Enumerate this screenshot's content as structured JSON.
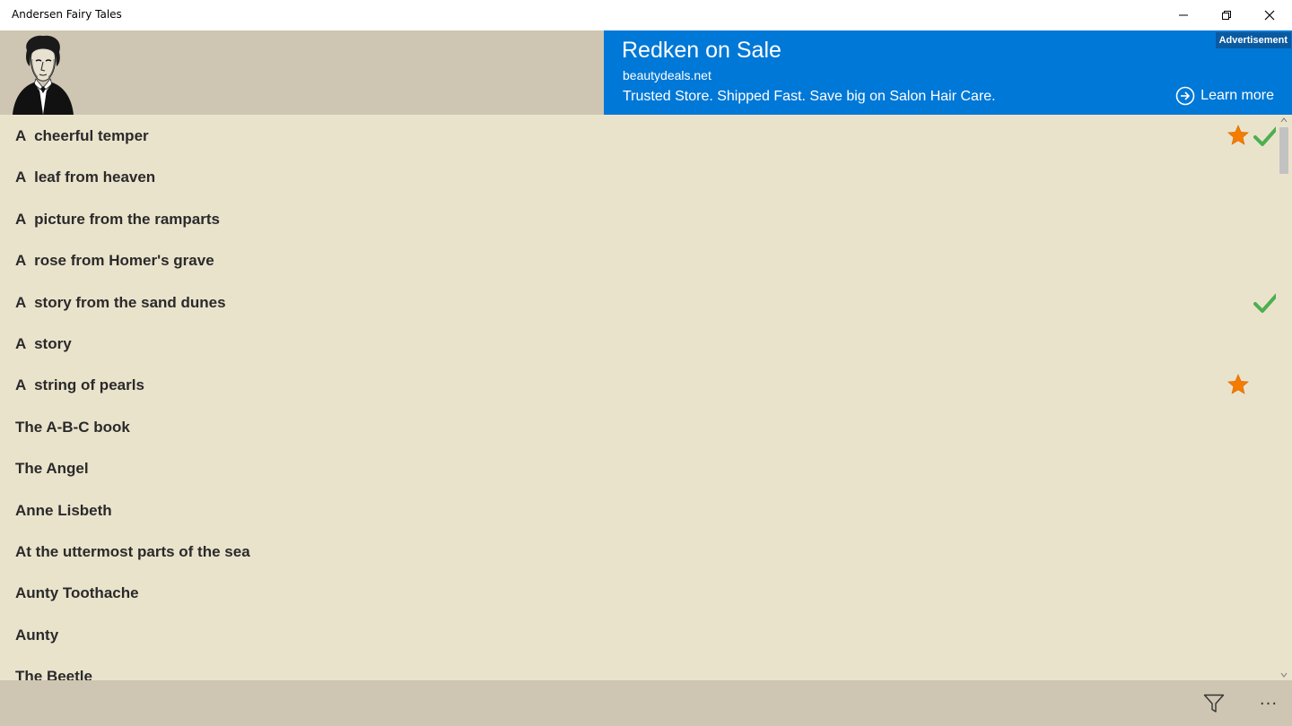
{
  "window": {
    "title": "Andersen Fairy Tales",
    "controls": [
      "minimize-icon",
      "restore-icon",
      "close-icon"
    ]
  },
  "header": {
    "portrait_icon": "andersen-portrait"
  },
  "ad": {
    "badge": "Advertisement",
    "title": "Redken on Sale",
    "domain": "beautydeals.net",
    "description": "Trusted Store. Shipped Fast. Save big on Salon Hair Care.",
    "cta": "Learn more",
    "background": "#0078d7"
  },
  "list": {
    "items": [
      {
        "label": "A  cheerful temper",
        "favorite": true,
        "read": true
      },
      {
        "label": "A  leaf from heaven",
        "favorite": false,
        "read": false
      },
      {
        "label": "A  picture from the ramparts",
        "favorite": false,
        "read": false
      },
      {
        "label": "A  rose from Homer's grave",
        "favorite": false,
        "read": false
      },
      {
        "label": "A  story from the sand dunes",
        "favorite": false,
        "read": true
      },
      {
        "label": "A  story",
        "favorite": false,
        "read": false
      },
      {
        "label": "A  string of pearls",
        "favorite": true,
        "read": false
      },
      {
        "label": "The A-B-C book",
        "favorite": false,
        "read": false
      },
      {
        "label": "The Angel",
        "favorite": false,
        "read": false
      },
      {
        "label": "Anne Lisbeth",
        "favorite": false,
        "read": false
      },
      {
        "label": "At the uttermost parts of the sea",
        "favorite": false,
        "read": false
      },
      {
        "label": "Aunty Toothache",
        "favorite": false,
        "read": false
      },
      {
        "label": "Aunty",
        "favorite": false,
        "read": false
      },
      {
        "label": "The Beetle",
        "favorite": false,
        "read": false
      }
    ],
    "star_color": "#f57c00",
    "check_color": "#4caf50"
  },
  "appbar": {
    "filter_icon": "filter-icon",
    "more_label": "···"
  },
  "colors": {
    "list_bg": "#eae3cc",
    "header_bg": "#cec6b2"
  }
}
